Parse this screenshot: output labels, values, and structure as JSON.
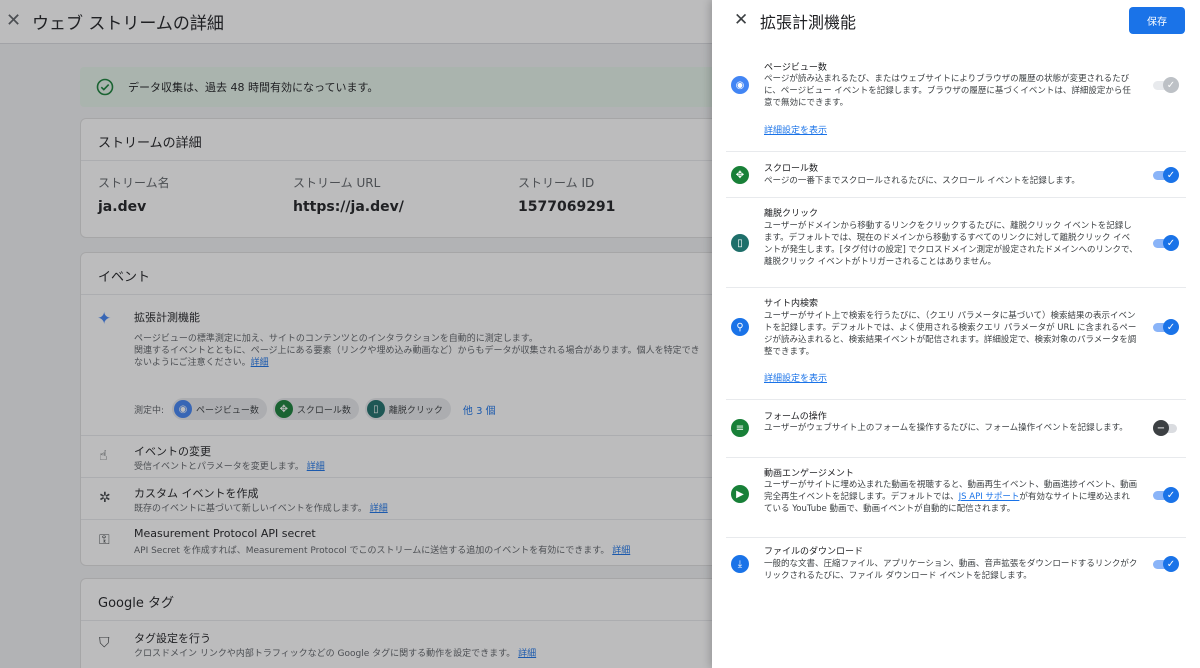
{
  "bg": {
    "title": "ウェブ ストリームの詳細",
    "banner": "データ収集は、過去 48 時間有効になっています。",
    "stream": {
      "header": "ストリームの詳細",
      "name_label": "ストリーム名",
      "name_value": "ja.dev",
      "url_label": "ストリーム URL",
      "url_value": "https://ja.dev/",
      "id_label": "ストリーム ID",
      "id_value": "1577069291"
    },
    "events": {
      "header": "イベント",
      "enhanced_title": "拡張計測機能",
      "enhanced_desc1": "ページビューの標準測定に加え、サイトのコンテンツとのインタラクションを自動的に測定します。",
      "enhanced_desc2": "関連するイベントとともに、ページ上にある要素（リンクや埋め込み動画など）からもデータが収集される場合があります。個人を特定でき",
      "enhanced_desc3": "ないようにご注意ください。",
      "enhanced_link": "詳細",
      "measuring_label": "測定中:",
      "chip1": "ページビュー数",
      "chip2": "スクロール数",
      "chip3": "離脱クリック",
      "more": "他 3 個",
      "rows": [
        {
          "title": "イベントの変更",
          "desc": "受信イベントとパラメータを変更します。",
          "link": "詳細"
        },
        {
          "title": "カスタム イベントを作成",
          "desc": "既存のイベントに基づいて新しいイベントを作成します。",
          "link": "詳細"
        },
        {
          "title": "Measurement Protocol API secret",
          "desc": "API Secret を作成すれば、Measurement Protocol でこのストリームに送信する追加のイベントを有効にできます。",
          "link": "詳細"
        }
      ]
    },
    "google": {
      "header": "Google タグ",
      "tag_title": "タグ設定を行う",
      "tag_desc": "クロスドメイン リンクや内部トラフィックなどの Google タグに関する動作を設定できます。",
      "tag_link": "詳細"
    }
  },
  "panel": {
    "title": "拡張計測機能",
    "save": "保存",
    "link_advanced": "詳細設定を表示",
    "settings": [
      {
        "title": "ページビュー数",
        "desc": "ページが読み込まれるたび、またはウェブサイトによりブラウザの履歴の状態が変更されるたびに、ページビュー イベントを記録します。ブラウザの履歴に基づくイベントは、詳細設定から任意で無効にできます。",
        "state": "disabled"
      },
      {
        "title": "スクロール数",
        "desc": "ページの一番下までスクロールされるたびに、スクロール イベントを記録します。",
        "state": "on"
      },
      {
        "title": "離脱クリック",
        "desc": "ユーザーがドメインから移動するリンクをクリックするたびに、離脱クリック イベントを記録します。デフォルトでは、現在のドメインから移動するすべてのリンクに対して離脱クリック イベントが発生します。[タグ付けの設定] でクロスドメイン測定が設定されたドメインへのリンクで、離脱クリック イベントがトリガーされることはありません。",
        "state": "on"
      },
      {
        "title": "サイト内検索",
        "desc": "ユーザーがサイト上で検索を行うたびに、（クエリ パラメータに基づいて）検索結果の表示イベントを記録します。デフォルトでは、よく使用される検索クエリ パラメータが URL に含まれるページが読み込まれると、検索結果イベントが配信されます。詳細設定で、検索対象のパラメータを調整できます。",
        "state": "on"
      },
      {
        "title": "フォームの操作",
        "desc": "ユーザーがウェブサイト上のフォームを操作するたびに、フォーム操作イベントを記録します。",
        "state": "off"
      },
      {
        "title": "動画エンゲージメント",
        "desc_a": "ユーザーがサイトに埋め込まれた動画を視聴すると、動画再生イベント、動画進捗イベント、動画完全再生イベントを記録します。デフォルトでは、",
        "desc_link": "JS API サポート",
        "desc_b": "が有効なサイトに埋め込まれている YouTube 動画で、動画イベントが自動的に配信されます。",
        "state": "on"
      },
      {
        "title": "ファイルのダウンロード",
        "desc": "一般的な文書、圧縮ファイル、アプリケーション、動画、音声拡張をダウンロードするリンクがクリックされるたびに、ファイル ダウンロード イベントを記録します。",
        "state": "on"
      }
    ]
  },
  "colors": {
    "primary": "#1a73e8",
    "icon_blue": "#4285f4",
    "icon_green": "#188038",
    "icon_teal": "#1e6f6a",
    "banner_bg": "#e6f4ea"
  }
}
